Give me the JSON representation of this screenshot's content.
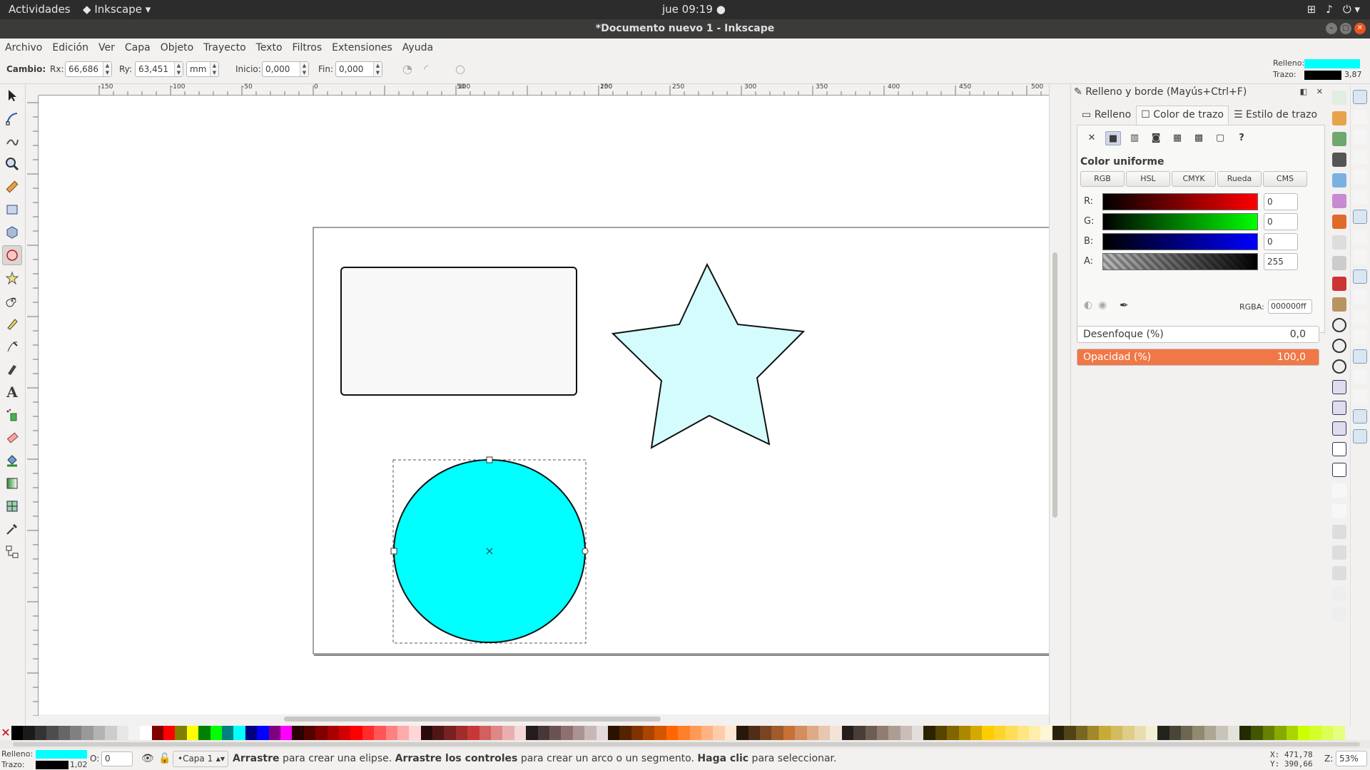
{
  "system_bar": {
    "activities": "Actividades",
    "app_menu": "Inkscape",
    "clock": "jue 09:19"
  },
  "window": {
    "title": "*Documento nuevo 1 - Inkscape"
  },
  "menu": [
    "Archivo",
    "Edición",
    "Ver",
    "Capa",
    "Objeto",
    "Trayecto",
    "Texto",
    "Filtros",
    "Extensiones",
    "Ayuda"
  ],
  "controls": {
    "change_label": "Cambio:",
    "rx_label": "Rx:",
    "rx_value": "66,686",
    "ry_label": "Ry:",
    "ry_value": "63,451",
    "unit": "mm",
    "start_label": "Inicio:",
    "start_value": "0,000",
    "end_label": "Fin:",
    "end_value": "0,000",
    "fill_label": "Relleno:",
    "stroke_label": "Trazo:",
    "stroke_width": "3,87",
    "fill_color": "#00ffff",
    "stroke_color": "#000000"
  },
  "rulers": {
    "h_ticks": [
      "-150",
      "-100",
      "-50",
      "0",
      "50",
      "100",
      "150",
      "200",
      "250",
      "300",
      "350",
      "400",
      "450",
      "500"
    ]
  },
  "panel": {
    "title": "Relleno y borde (Mayús+Ctrl+F)",
    "tabs": [
      "Relleno",
      "Color de trazo",
      "Estilo de trazo"
    ],
    "unknown_paint": "?",
    "subheading": "Color uniforme",
    "modes": [
      "RGB",
      "HSL",
      "CMYK",
      "Rueda",
      "CMS"
    ],
    "channels": [
      {
        "label": "R:",
        "value": "0"
      },
      {
        "label": "G:",
        "value": "0"
      },
      {
        "label": "B:",
        "value": "0"
      },
      {
        "label": "A:",
        "value": "255"
      }
    ],
    "rgba_label": "RGBA:",
    "rgba_value": "000000ff",
    "blur_label": "Desenfoque (%)",
    "blur_value": "0,0",
    "opacity_label": "Opacidad (%)",
    "opacity_value": "100,0",
    "accent": "#f07746"
  },
  "status": {
    "fill_label": "Relleno:",
    "stroke_label": "Trazo:",
    "stroke_width": "1,02",
    "o_label": "O:",
    "o_value": "0",
    "layer": "•Capa 1",
    "msg_b1": "Arrastre",
    "msg_t1": " para crear una elipse. ",
    "msg_b2": "Arrastre los controles",
    "msg_t2": " para crear un arco o un segmento. ",
    "msg_b3": "Haga clic",
    "msg_t3": " para seleccionar.",
    "x_label": "X:",
    "x_value": "471,78",
    "y_label": "Y:",
    "y_value": "390,66",
    "z_label": "Z:",
    "zoom": "53%"
  },
  "palette": [
    "#000000",
    "#1a1a1a",
    "#333333",
    "#4d4d4d",
    "#666666",
    "#808080",
    "#999999",
    "#b3b3b3",
    "#cccccc",
    "#e6e6e6",
    "#f2f2f2",
    "#ffffff",
    "#800000",
    "#ff0000",
    "#808000",
    "#ffff00",
    "#008000",
    "#00ff00",
    "#008080",
    "#00ffff",
    "#000080",
    "#0000ff",
    "#800080",
    "#ff00ff",
    "#2b0000",
    "#550000",
    "#800000",
    "#aa0000",
    "#d40000",
    "#ff0000",
    "#ff2a2a",
    "#ff5555",
    "#ff8080",
    "#ffaaaa",
    "#ffd5d5",
    "#280b0b",
    "#501616",
    "#782121",
    "#a02c2c",
    "#c83737",
    "#d35f5f",
    "#de8787",
    "#e9afaf",
    "#f4d7d7",
    "#241c1c",
    "#483737",
    "#6c5353",
    "#916f6f",
    "#ac9393",
    "#c8b7b7",
    "#e3dbdb",
    "#2b1100",
    "#552200",
    "#803300",
    "#aa4400",
    "#d45500",
    "#ff6600",
    "#ff7f2a",
    "#ff9955",
    "#ffb380",
    "#ffccaa",
    "#ffe6d5",
    "#28170b",
    "#502d16",
    "#784421",
    "#a05a2c",
    "#c87137",
    "#d38d5f",
    "#deaa87",
    "#e9c6af",
    "#f4e3d7",
    "#241f1c",
    "#483e37",
    "#6c5d53",
    "#917c6f",
    "#ac9d93",
    "#c8beb7",
    "#e3dedb",
    "#2b2200",
    "#554400",
    "#806600",
    "#aa8800",
    "#d4aa00",
    "#ffcc00",
    "#ffd42a",
    "#ffdd55",
    "#ffe680",
    "#ffeeaa",
    "#fff6d5",
    "#28220b",
    "#504416",
    "#786721",
    "#a0892c",
    "#c8ab37",
    "#d3bc5f",
    "#decd87",
    "#e9ddaf",
    "#f4eed7",
    "#24221c",
    "#484537",
    "#6c6753",
    "#918a6f",
    "#aca793",
    "#c8c4b7",
    "#e3e2db",
    "#222b00",
    "#445500",
    "#668000",
    "#88aa00",
    "#aad400",
    "#ccff00",
    "#d4ff2a",
    "#ddff55",
    "#e5ff80"
  ]
}
